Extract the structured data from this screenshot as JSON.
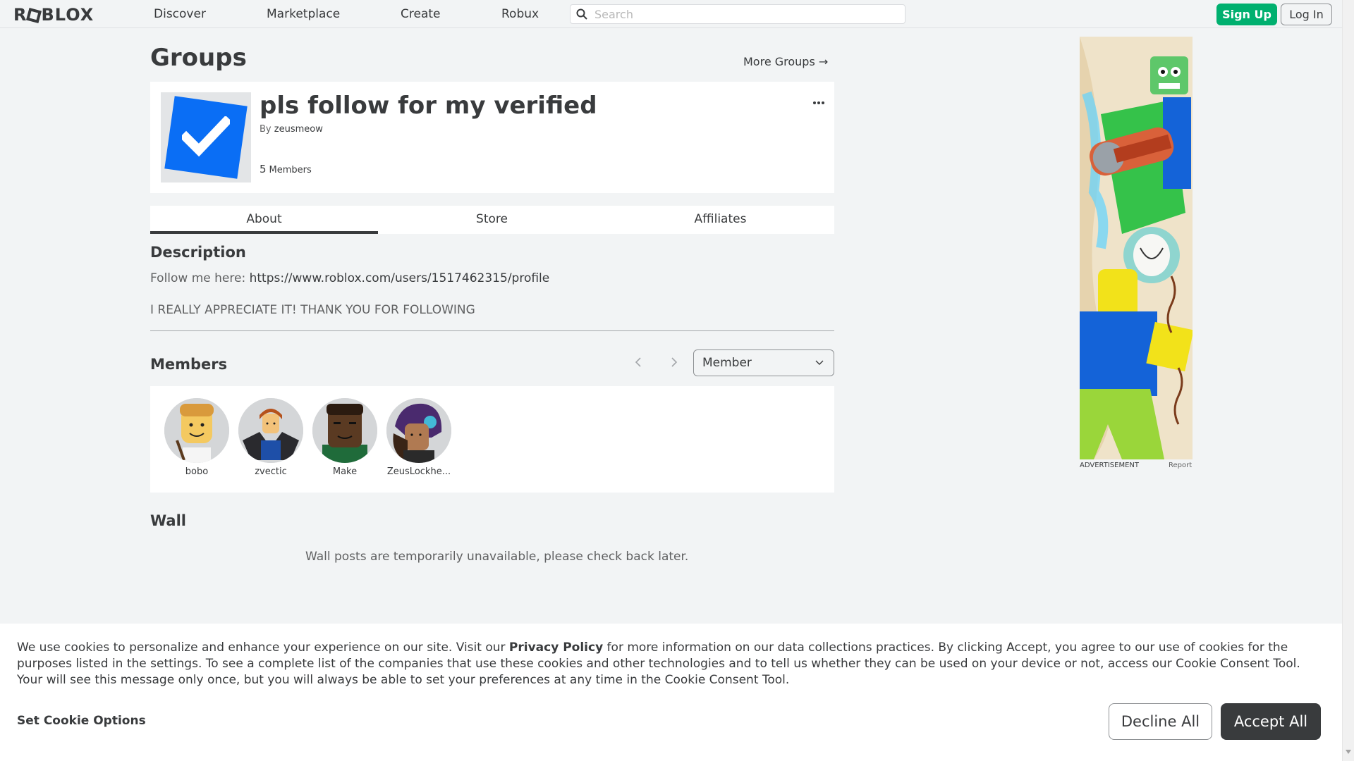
{
  "nav": {
    "logo": "ROBLOX",
    "links": [
      "Discover",
      "Marketplace",
      "Create",
      "Robux"
    ],
    "search_placeholder": "Search",
    "signup_label": "Sign Up",
    "login_label": "Log In"
  },
  "page": {
    "title": "Groups",
    "more_groups": "More Groups →"
  },
  "group": {
    "name": "pls follow for my verified",
    "owner_prefix": "By",
    "owner": "zeusmeow",
    "member_count": "5",
    "member_label": "Members"
  },
  "tabs": [
    "About",
    "Store",
    "Affiliates"
  ],
  "description": {
    "heading": "Description",
    "line1_prefix": "Follow me here: ",
    "line1_link": "https://www.roblox.com/users/1517462315/profile",
    "line2": "I REALLY APPRECIATE IT! THANK YOU FOR FOLLOWING"
  },
  "members": {
    "heading": "Members",
    "role_selected": "Member",
    "list": [
      {
        "name": "bobo"
      },
      {
        "name": "zvectic"
      },
      {
        "name": "Make"
      },
      {
        "name": "ZeusLockhe..."
      }
    ]
  },
  "wall": {
    "heading": "Wall",
    "message": "Wall posts are temporarily unavailable, please check back later."
  },
  "ad": {
    "label": "ADVERTISEMENT",
    "report": "Report"
  },
  "cookie": {
    "text_before": "We use cookies to personalize and enhance your experience on our site. Visit our ",
    "privacy_link": "Privacy Policy",
    "text_after": " for more information on our data collections practices. By clicking Accept, you agree to our use of cookies for the purposes listed in the settings. To see a complete list of the companies that use these cookies and other technologies and to tell us whether they can be used on your device or not, access our Cookie Consent Tool. Your will see this message only once, but you will always be able to set your preferences at any time in the Cookie Consent Tool.",
    "options_label": "Set Cookie Options",
    "decline_label": "Decline All",
    "accept_label": "Accept All"
  },
  "colors": {
    "brand_green": "#00b06f",
    "emblem_blue": "#0a6ef5",
    "text_dark": "#393b3d",
    "page_bg": "#f2f4f5"
  }
}
